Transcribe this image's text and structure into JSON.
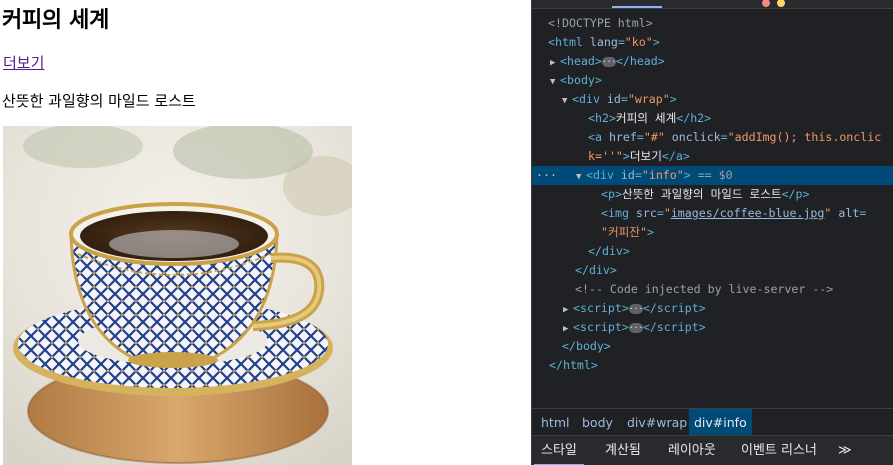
{
  "page": {
    "heading": "커피의 세계",
    "more_link": "더보기",
    "description": "산뜻한 과일향의 마일드 로스트",
    "image_alt": "커피잔"
  },
  "devtools": {
    "tree": {
      "doctype": "<!DOCTYPE html>",
      "html_open": "<html lang=\"ko\">",
      "head": "head",
      "body": "body",
      "wrap_id": "wrap",
      "h2_text": "커피의 세계",
      "a_href": "#",
      "a_onclick_1": "addImg(); this.onclic",
      "a_onclick_2": "k=''",
      "a_text": "더보기",
      "info_id": "info",
      "selected_marker": "== $0",
      "p_text": "산뜻한 과일향의 마일드 로스트",
      "img_src": "images/coffee-blue.jpg",
      "img_alt": "커피잔",
      "comment": "<!-- Code injected by live-server -->"
    },
    "breadcrumbs": [
      "html",
      "body",
      "div#wrap",
      "div#info"
    ],
    "bottom_tabs": [
      "스타일",
      "계산됨",
      "레이아웃",
      "이벤트 리스너"
    ],
    "more_tabs": "≫",
    "accent": "#004a77"
  }
}
